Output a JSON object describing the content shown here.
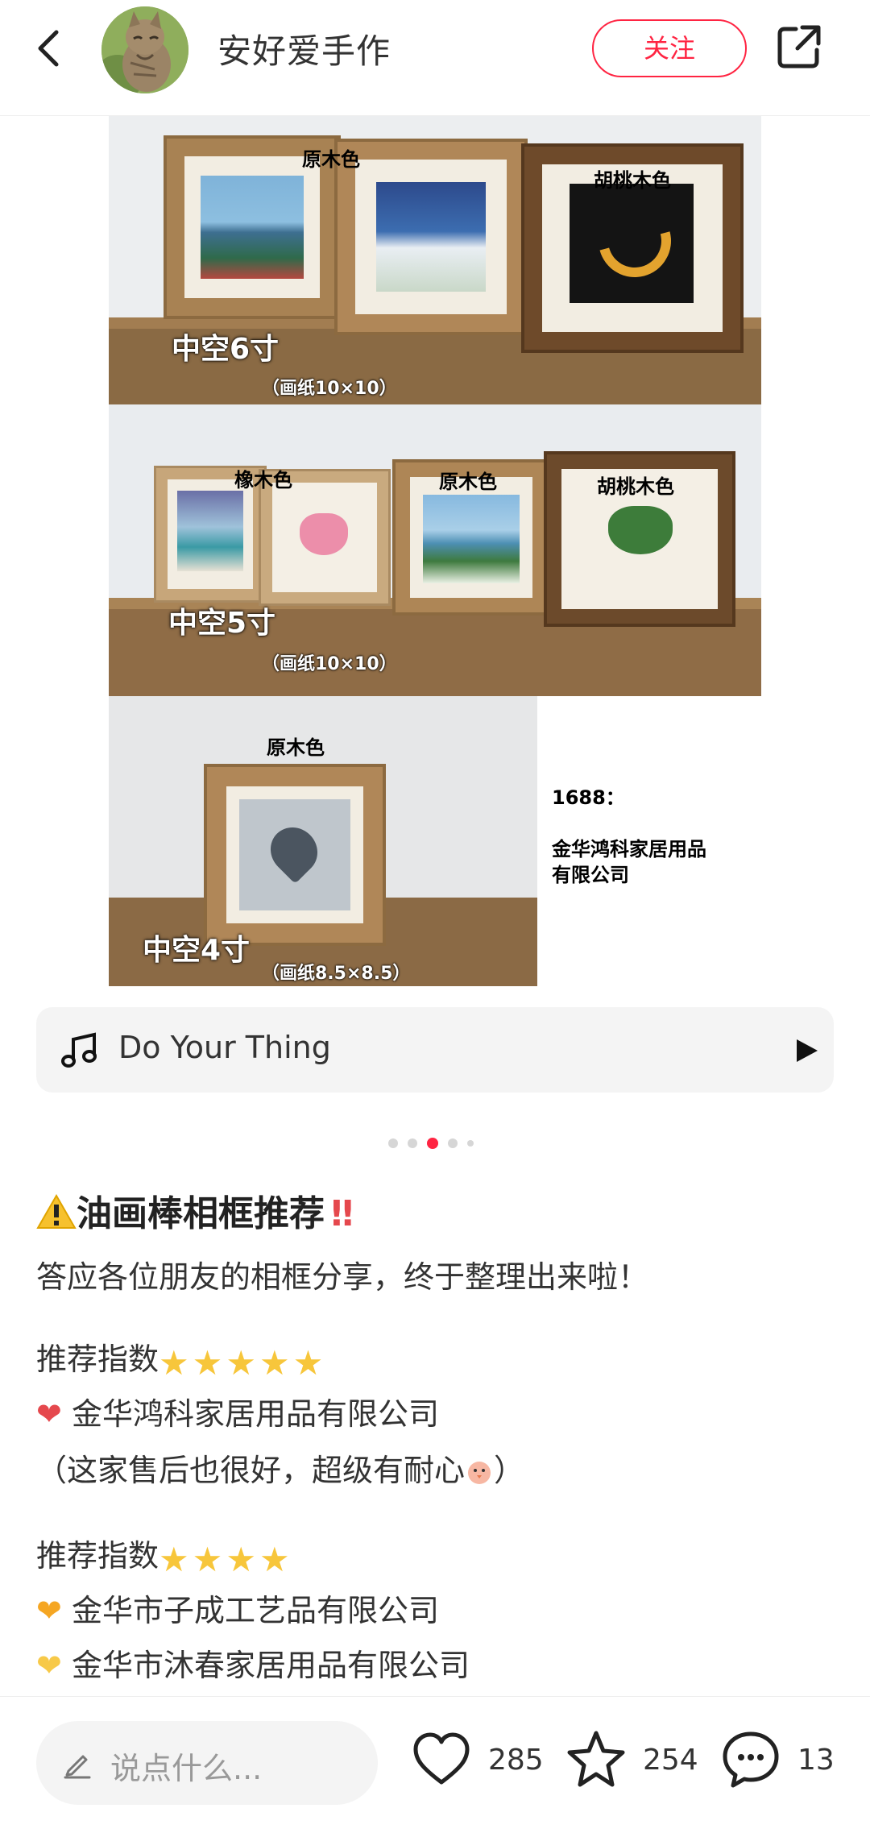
{
  "header": {
    "author_name": "安好爱手作",
    "follow_label": "关注"
  },
  "photo": {
    "panel1": {
      "labels": [
        "原木色",
        "胡桃木色"
      ],
      "size": "中空6寸",
      "paper": "（画纸10×10）"
    },
    "panel2": {
      "labels": [
        "橡木色",
        "原木色",
        "胡桃木色"
      ],
      "size": "中空5寸",
      "paper": "（画纸10×10）"
    },
    "panel3": {
      "label": "原木色",
      "size": "中空4寸",
      "paper": "（画纸8.5×8.5）"
    },
    "side_note": {
      "line1": "1688：",
      "line2": "金华鸿科家居用品",
      "line3": "有限公司"
    }
  },
  "music": {
    "title": "Do Your Thing"
  },
  "pagination": {
    "total": 5,
    "active_index": 2,
    "active_color": "#ff2442"
  },
  "post": {
    "title_icon": "⚠️",
    "title": "油画棒相框推荐",
    "title_suffix": "‼️",
    "intro": "答应各位朋友的相框分享，终于整理出来啦！",
    "groups": [
      {
        "rating_label": "推荐指数",
        "stars": 5,
        "items": [
          {
            "heart_color": "#e5484d",
            "text": "金华鸿科家居用品有限公司"
          }
        ],
        "note": "（这家售后也很好，超级有耐心",
        "note_end": "）"
      },
      {
        "rating_label": "推荐指数",
        "stars": 4,
        "items": [
          {
            "heart_color": "#f5a623",
            "text": "金华市子成工艺品有限公司"
          },
          {
            "heart_color": "#f7c948",
            "text": "金华市沐春家居用品有限公司"
          }
        ]
      }
    ]
  },
  "bottom": {
    "comment_placeholder": "说点什么...",
    "likes": "285",
    "favorites": "254",
    "comments": "13"
  }
}
